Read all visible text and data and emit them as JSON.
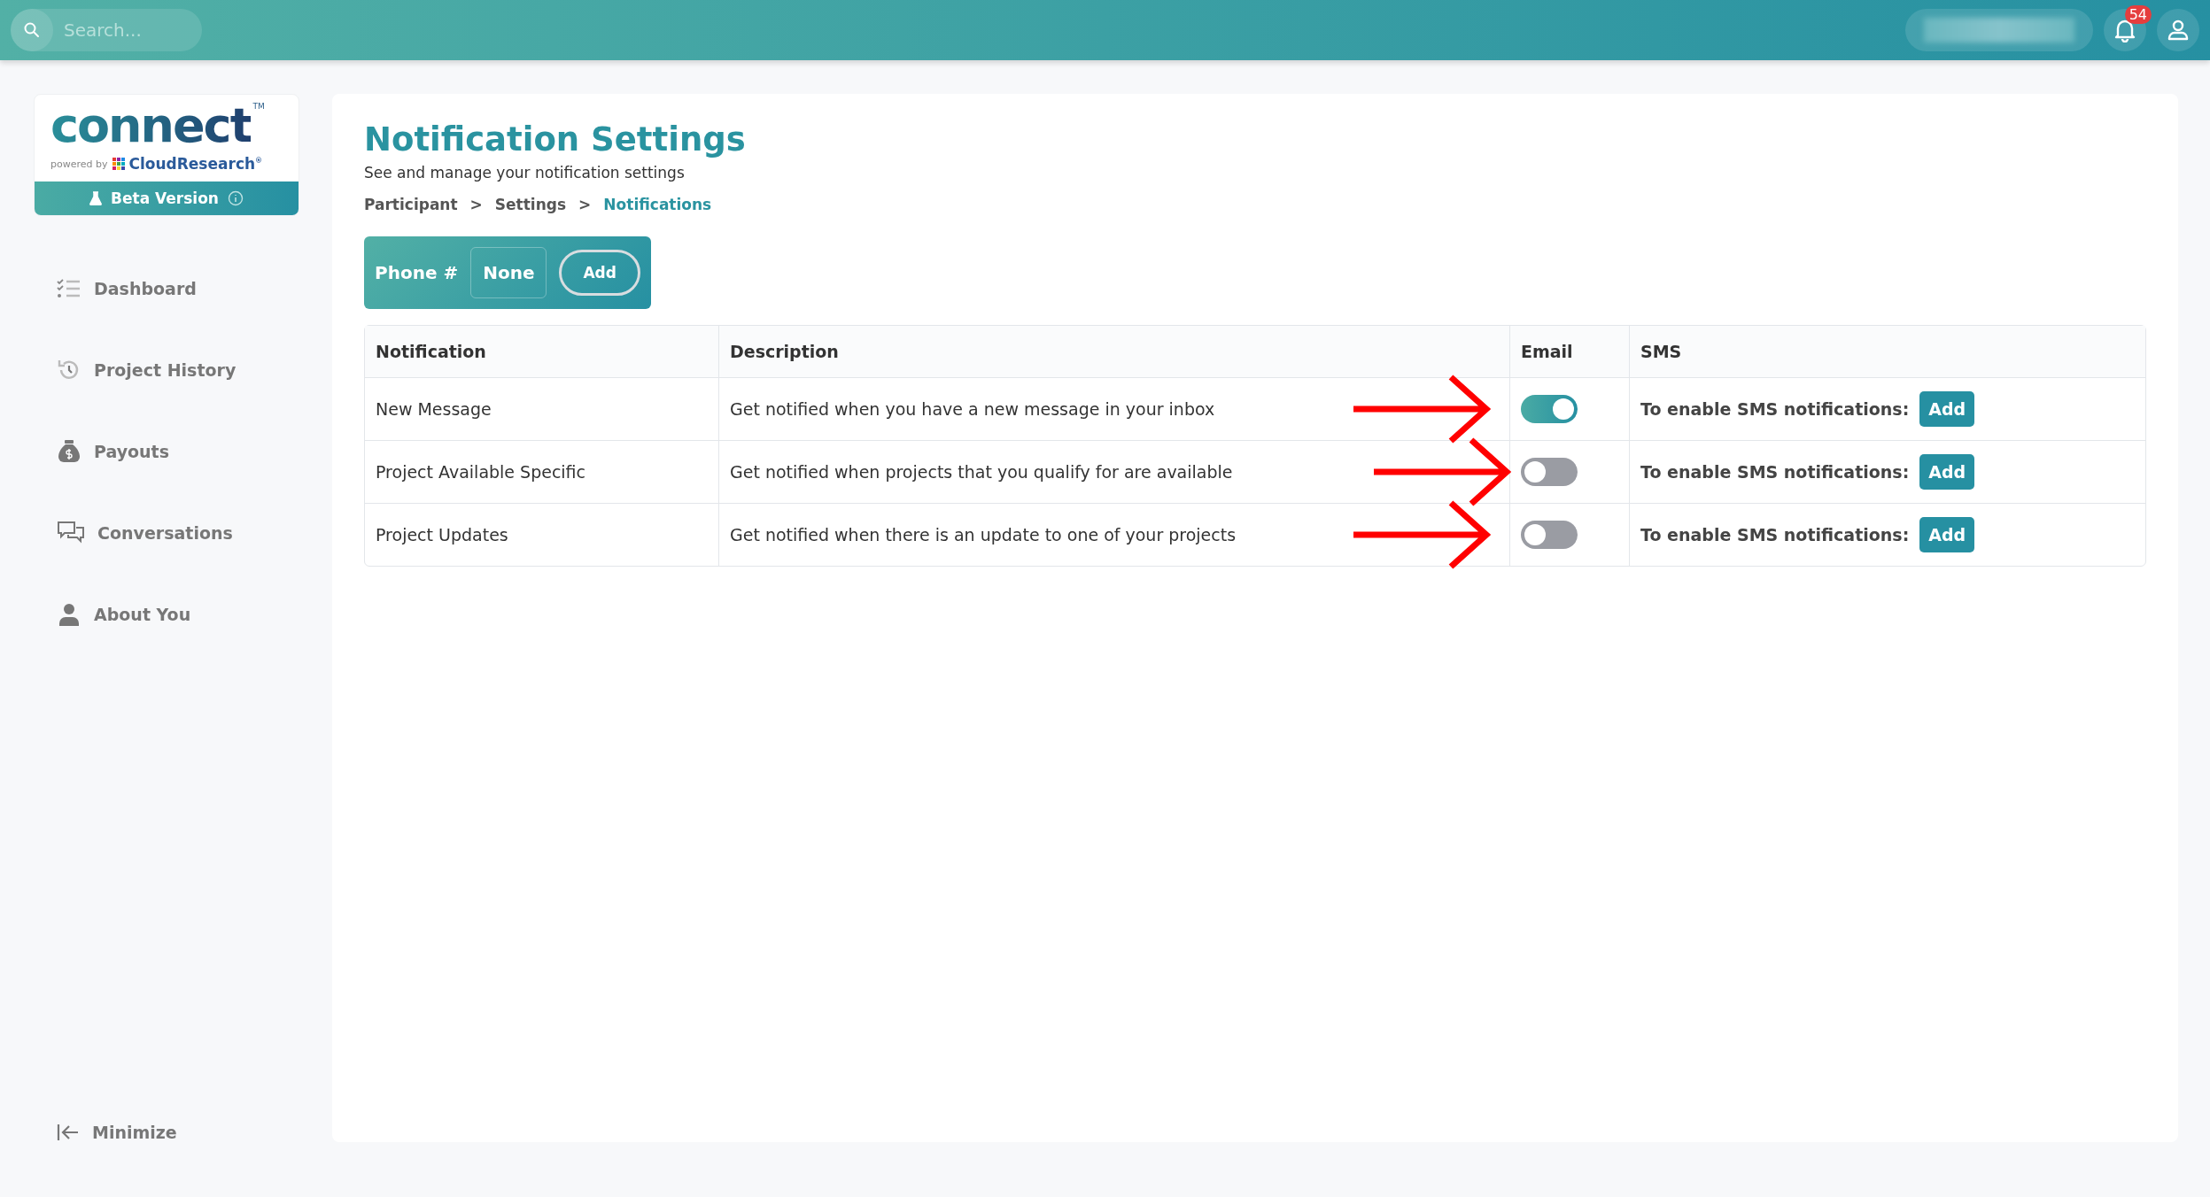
{
  "top_bar": {
    "search": {
      "placeholder": "Search..."
    },
    "notifications_count": "54"
  },
  "logo": {
    "wordmark": "connect",
    "tm": "TM",
    "powered_by": "powered by",
    "brand": "CloudResearch",
    "registered": "®"
  },
  "beta_banner": {
    "label": "Beta Version"
  },
  "sidebar": {
    "items": [
      {
        "label": "Dashboard",
        "selected": false
      },
      {
        "label": "Project History",
        "selected": false
      },
      {
        "label": "Payouts",
        "selected": false
      },
      {
        "label": "Conversations",
        "selected": false
      },
      {
        "label": "About You",
        "selected": false
      }
    ],
    "minimize": "Minimize"
  },
  "page": {
    "title": "Notification Settings",
    "subtitle": "See and manage your notification settings",
    "breadcrumb": [
      {
        "label": "Participant",
        "current": false
      },
      {
        "label": "Settings",
        "current": false
      },
      {
        "label": "Notifications",
        "current": true
      }
    ],
    "breadcrumb_separator": ">",
    "phone": {
      "label": "Phone #",
      "value": "None",
      "button": "Add"
    }
  },
  "table": {
    "columns": [
      "Notification",
      "Description",
      "Email",
      "SMS"
    ],
    "rows": [
      {
        "notification": "New Message",
        "description": "Get notified when you have a new message in your inbox",
        "email_on": true,
        "sms_text": "To enable SMS notifications:",
        "sms_button": "Add",
        "arrow": true
      },
      {
        "notification": "Project Available Specific",
        "description": "Get notified when projects that you qualify for are available",
        "email_on": false,
        "sms_text": "To enable SMS notifications:",
        "sms_button": "Add",
        "arrow": true
      },
      {
        "notification": "Project Updates",
        "description": "Get notified when there is an update to one of your projects",
        "email_on": false,
        "sms_text": "To enable SMS notifications:",
        "sms_button": "Add",
        "arrow": true
      }
    ]
  }
}
